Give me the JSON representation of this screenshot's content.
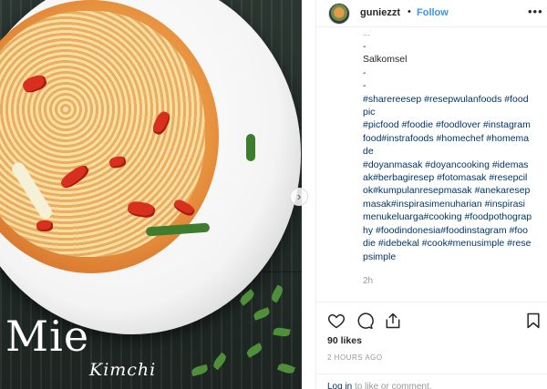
{
  "photo": {
    "overlay_title": "Mie",
    "overlay_subtitle": "Kimchi"
  },
  "post": {
    "username": "guniezzt",
    "separator": "•",
    "follow_label": "Follow",
    "more_icon": "more-options-icon",
    "caption": {
      "cut_line": "...",
      "lines": [
        "-",
        "Salkomsel",
        "-",
        "-"
      ],
      "hashtags": "#sharereesep #resepwulanfoods #foodpic\n#picfood #foodie #foodlover #instagramfood#instrafoods #homechef #homemade\n#doyanmasak #doyancooking #idemasak#berbagiresep #fotomasak #resepcilok#kumpulanresepmasak #anekaresepmasak#inspirasimenuharian #inspirasimenukeluarga#cooking  #foodpothography #foodindonesia#foodinstagram #foodie #idebekal #cook#menusimple #resepsimple"
    },
    "time_ago": "2h",
    "likes": "90 likes",
    "date": "2 HOURS AGO",
    "login_prompt": {
      "link": "Log in",
      "rest": " to like or comment."
    }
  },
  "colors": {
    "link": "#003569",
    "follow": "#3897f0",
    "muted": "#999999",
    "text": "#262626"
  }
}
